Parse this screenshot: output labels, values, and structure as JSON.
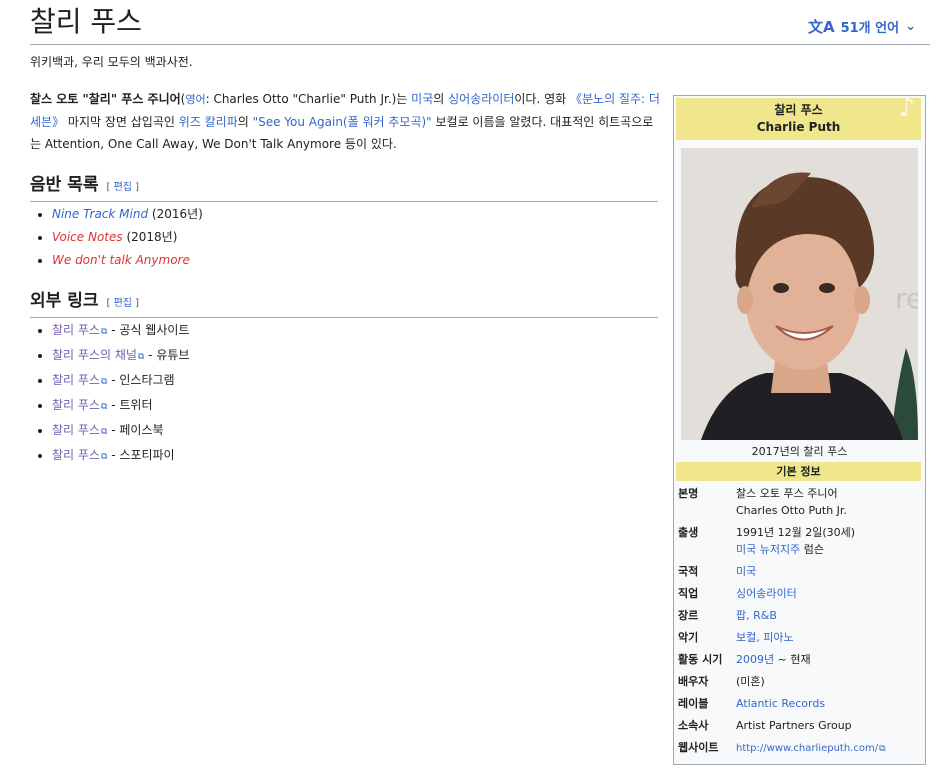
{
  "page": {
    "title": "찰리 푸스",
    "language_count": "51개 언어",
    "tagline": "위키백과, 우리 모두의 백과사전."
  },
  "lead": {
    "name_bold": "찰스 오토 \"찰리\" 푸스 주니어",
    "paren_open": "(",
    "lang_link": "영어",
    "english_name": ": Charles Otto \"Charlie\" Puth Jr.)는 ",
    "country_link": "미국",
    "of": "의 ",
    "job_link": "싱어송라이터",
    "after_job": "이다. 영화 ",
    "film_link": "《분노의 질주: 더 세븐》",
    "after_film": " 마지막 장면 삽입곡인 ",
    "wiz_link": "위즈 칼리파",
    "of2": "의 ",
    "song_link": "\"See You Again(폴 워커 추모곡)\"",
    "after_song": " 보컬로 이름을 알렸다. 대표적인 히트곡으로는 Attention, One Call Away, We Don't Talk Anymore 등이 있다."
  },
  "sections": {
    "discography": {
      "heading": "음반 목록",
      "edit_open": "[ ",
      "edit": "편집",
      "edit_close": " ]"
    },
    "external": {
      "heading": "외부 링크",
      "edit_open": "[ ",
      "edit": "편집",
      "edit_close": " ]"
    }
  },
  "albums": [
    {
      "title": "Nine Track Mind",
      "year": " (2016년)"
    },
    {
      "title": "Voice Notes",
      "year": " (2018년)"
    },
    {
      "title": "We don't talk Anymore",
      "year": ""
    }
  ],
  "links": [
    {
      "text": "찰리 푸스",
      "desc": " - 공식 웹사이트"
    },
    {
      "text": "찰리 푸스의 채널",
      "desc": " - 유튜브"
    },
    {
      "text": "찰리 푸스",
      "desc": " - 인스타그램"
    },
    {
      "text": "찰리 푸스",
      "desc": " - 트위터"
    },
    {
      "text": "찰리 푸스",
      "desc": " - 페이스북"
    },
    {
      "text": "찰리 푸스",
      "desc": " - 스포티파이"
    }
  ],
  "infobox": {
    "name_ko": "찰리 푸스",
    "name_en": "Charlie Puth",
    "caption": "2017년의 찰리 푸스",
    "basic_info": "기본 정보",
    "rows": {
      "real_name": {
        "k": "본명",
        "v1": "찰스 오토 푸스 주니어",
        "v2": "Charles Otto Puth Jr."
      },
      "born": {
        "k": "출생",
        "v1": "1991년 12월 2일(30세)",
        "v2a": "미국 뉴저지주",
        "v2b": " 럼슨"
      },
      "nationality": {
        "k": "국적",
        "v": "미국"
      },
      "occupation": {
        "k": "직업",
        "v": "싱어송라이터"
      },
      "genre": {
        "k": "장르",
        "v": "팝, R&B"
      },
      "instrument": {
        "k": "악기",
        "v": "보컬, 피아노"
      },
      "active": {
        "k": "활동 시기",
        "v_link": "2009년",
        "v_rest": " ~ 현재"
      },
      "spouse": {
        "k": "배우자",
        "v": "(미혼)"
      },
      "label": {
        "k": "레이블",
        "v": "Atlantic Records"
      },
      "agency": {
        "k": "소속사",
        "v": "Artist Partners Group"
      },
      "website": {
        "k": "웹사이트",
        "v": "http://www.charlieputh.com/"
      }
    }
  },
  "colors": {
    "link": "#3366cc",
    "visited": "#795cb2",
    "redlink": "#dd3333",
    "infobox_header": "#f0e68c"
  }
}
